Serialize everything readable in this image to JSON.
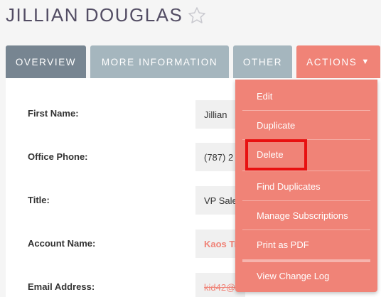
{
  "header": {
    "title": "JILLIAN DOUGLAS",
    "favorite_icon": "star-outline-icon"
  },
  "tabs": [
    {
      "label": "OVERVIEW",
      "active": true
    },
    {
      "label": "MORE INFORMATION"
    },
    {
      "label": "OTHER"
    },
    {
      "label": "ACTIONS",
      "caret": "▼"
    }
  ],
  "fields": [
    {
      "label": "First Name:",
      "value": "Jillian"
    },
    {
      "label": "Office Phone:",
      "value": "(787) 2"
    },
    {
      "label": "Title:",
      "value": "VP Sale"
    },
    {
      "label": "Account Name:",
      "value": "Kaos Tr"
    },
    {
      "label": "Email Address:",
      "value": "kid42@"
    }
  ],
  "actions_menu": {
    "items": [
      "Edit",
      "Duplicate",
      "Delete",
      "Find Duplicates",
      "Manage Subscriptions",
      "Print as PDF",
      "View Change Log"
    ],
    "highlighted": "Delete"
  },
  "colors": {
    "accent": "#f08377",
    "tab_active": "#778591",
    "tab_inactive": "#a5b6be",
    "highlight_border": "#e81010",
    "title": "#534d64"
  }
}
